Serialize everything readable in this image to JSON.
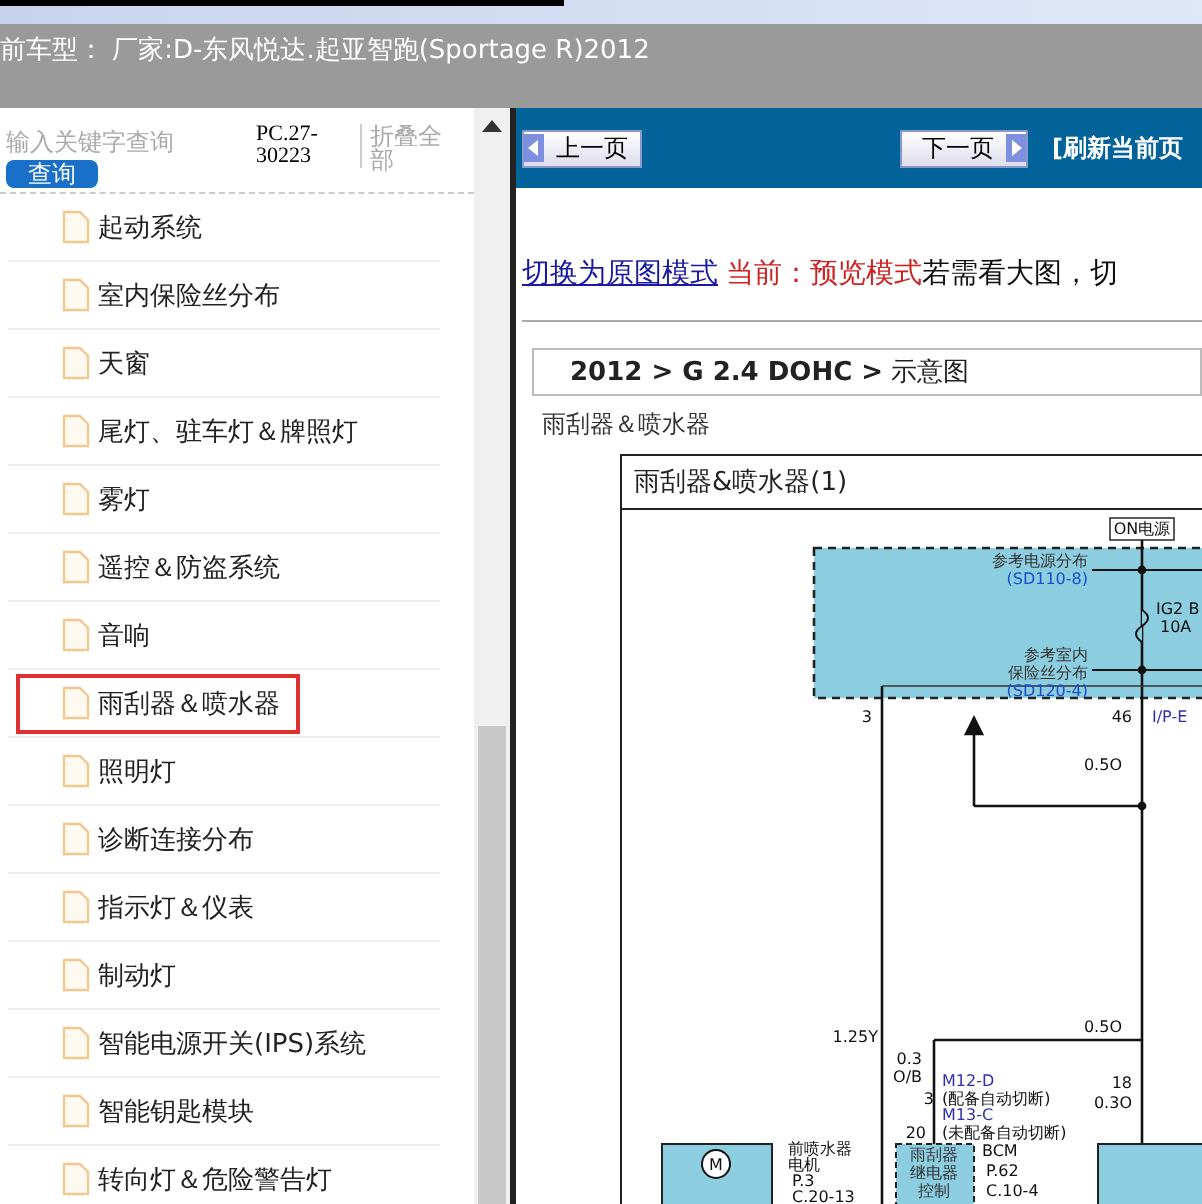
{
  "header": {
    "title": "前车型： 厂家:D-东风悦达.起亚智跑(Sportage R)2012"
  },
  "sidebar": {
    "search": {
      "placeholder": "输入关键字查询"
    },
    "search_button": "查询",
    "code": "PC.27-30223",
    "collapse_all": "折叠全部",
    "items": [
      {
        "label": "起动系统",
        "selected": false
      },
      {
        "label": "室内保险丝分布",
        "selected": false
      },
      {
        "label": "天窗",
        "selected": false
      },
      {
        "label": "尾灯、驻车灯＆牌照灯",
        "selected": false
      },
      {
        "label": "雾灯",
        "selected": false
      },
      {
        "label": "遥控＆防盗系统",
        "selected": false
      },
      {
        "label": "音响",
        "selected": false
      },
      {
        "label": "雨刮器＆喷水器",
        "selected": true
      },
      {
        "label": "照明灯",
        "selected": false
      },
      {
        "label": "诊断连接分布",
        "selected": false
      },
      {
        "label": "指示灯＆仪表",
        "selected": false
      },
      {
        "label": "制动灯",
        "selected": false
      },
      {
        "label": "智能电源开关(IPS)系统",
        "selected": false
      },
      {
        "label": "智能钥匙模块",
        "selected": false
      },
      {
        "label": "转向灯＆危险警告灯",
        "selected": false
      }
    ]
  },
  "toolbar": {
    "prev_button": "上一页",
    "next_button": "下一页",
    "refresh_link": "[刷新当前页"
  },
  "mode_line": {
    "switch_link": "切换为原图模式",
    "current": "当前：预览模式",
    "hint": "若需看大图，切"
  },
  "breadcrumb": "**2012 > G 2.4 DOHC >** 示意图",
  "section_title": "雨刮器＆喷水器",
  "diagram": {
    "title": "雨刮器&喷水器(1)",
    "labels": [
      {
        "text": "ON电源"
      },
      {
        "text": "参考电源分布"
      },
      {
        "text": "(SD110-8)"
      },
      {
        "text": "IG2 B"
      },
      {
        "text": "10A"
      },
      {
        "text": "参考室内"
      },
      {
        "text": "保险丝分布"
      },
      {
        "text": "(SD120-4)"
      },
      {
        "text": "3"
      },
      {
        "text": "46"
      },
      {
        "text": "I/P-E"
      },
      {
        "text": "0.5O"
      },
      {
        "text": "0.5O"
      },
      {
        "text": "1.25Y"
      },
      {
        "text": "0.3"
      },
      {
        "text": "O/B"
      },
      {
        "text": "M12-D"
      },
      {
        "text": "3"
      },
      {
        "text": "(配备自动切断)"
      },
      {
        "text": "M13-C"
      },
      {
        "text": "20"
      },
      {
        "text": "(未配备自动切断)"
      },
      {
        "text": "18"
      },
      {
        "text": "0.3O"
      },
      {
        "text": "M"
      },
      {
        "text": "前喷水器"
      },
      {
        "text": "电机"
      },
      {
        "text": "P.3"
      },
      {
        "text": "C.20-13"
      },
      {
        "text": "雨刮器"
      },
      {
        "text": "继电器"
      },
      {
        "text": "控制"
      },
      {
        "text": "BCM"
      },
      {
        "text": "P.62"
      },
      {
        "text": "C.10-4"
      }
    ]
  }
}
